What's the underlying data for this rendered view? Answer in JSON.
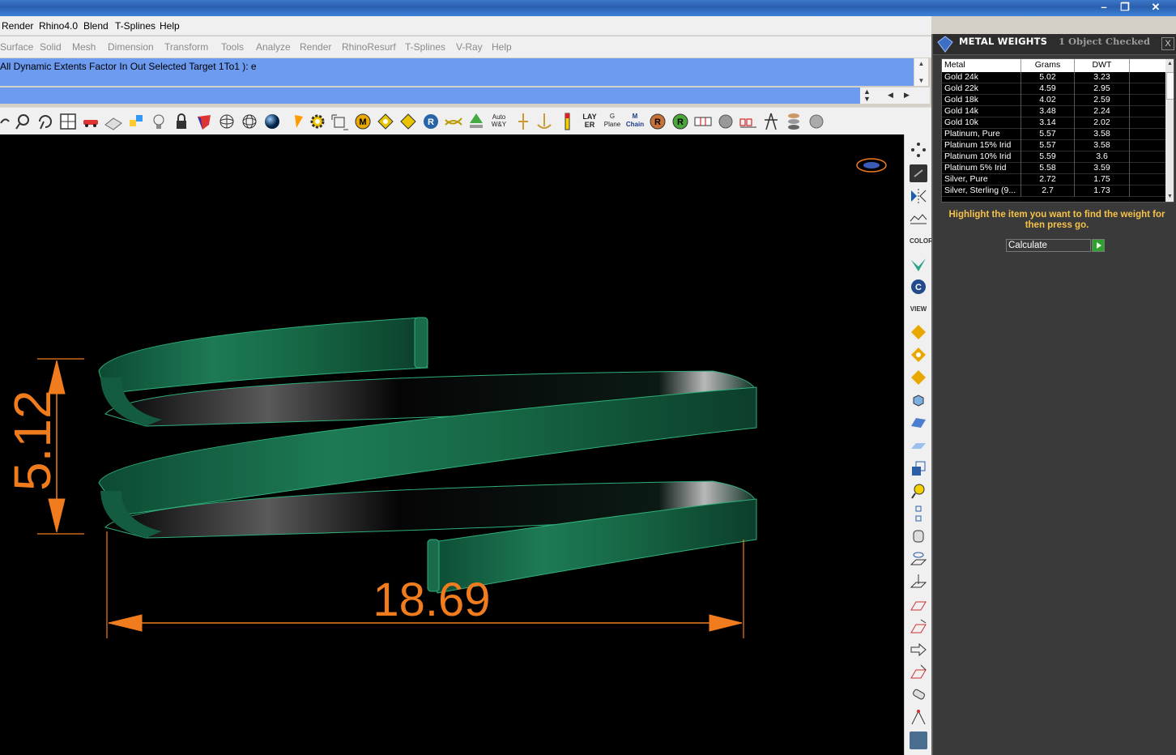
{
  "menubar": [
    "Render",
    "Rhino4.0",
    "Blend",
    "T-Splines",
    "Help"
  ],
  "toolbar_tabs": [
    "Surface",
    "Solid",
    "Mesh",
    "Dimension",
    "Transform",
    "Tools",
    "Analyze",
    "Render",
    "RhinoResurf",
    "T-Splines",
    "V-Ray",
    "Help"
  ],
  "command_line": "All  Dynamic  Extents  Factor  In  Out  Selected  Target  1To1 ): e",
  "toolbar_icon_labels": {
    "auto_wy": "Auto W&Y",
    "layer": "LAY ER",
    "gplane": "G Plane",
    "mchain": "M Chain"
  },
  "vtool_labels": {
    "color": "COLOR",
    "view": "VIEW"
  },
  "dimensions": {
    "height": "5.12",
    "width": "18.69"
  },
  "panel": {
    "title": "METAL WEIGHTS",
    "status": "1 Object Checked",
    "close": "X",
    "columns": [
      "Metal",
      "Grams",
      "DWT"
    ],
    "rows": [
      {
        "metal": "Gold 24k",
        "grams": "5.02",
        "dwt": "3.23"
      },
      {
        "metal": "Gold 22k",
        "grams": "4.59",
        "dwt": "2.95"
      },
      {
        "metal": "Gold 18k",
        "grams": "4.02",
        "dwt": "2.59"
      },
      {
        "metal": "Gold 14k",
        "grams": "3.48",
        "dwt": "2.24"
      },
      {
        "metal": "Gold 10k",
        "grams": "3.14",
        "dwt": "2.02"
      },
      {
        "metal": "Platinum, Pure",
        "grams": "5.57",
        "dwt": "3.58"
      },
      {
        "metal": "Platinum 15% Irid",
        "grams": "5.57",
        "dwt": "3.58"
      },
      {
        "metal": "Platinum 10% Irid",
        "grams": "5.59",
        "dwt": "3.6"
      },
      {
        "metal": "Platinum 5% Irid",
        "grams": "5.58",
        "dwt": "3.59"
      },
      {
        "metal": "Silver, Pure",
        "grams": "2.72",
        "dwt": "1.75"
      },
      {
        "metal": "Silver, Sterling (9...",
        "grams": "2.7",
        "dwt": "1.73"
      }
    ],
    "hint": "Highlight the item you want to find the weight for then press go.",
    "calculate_label": "Calculate"
  },
  "colors": {
    "accent_dim": "#f07c1e",
    "ring": "#1f7d5a",
    "cmdline_bg": "#6c9bf0",
    "hint": "#f5c24a"
  }
}
